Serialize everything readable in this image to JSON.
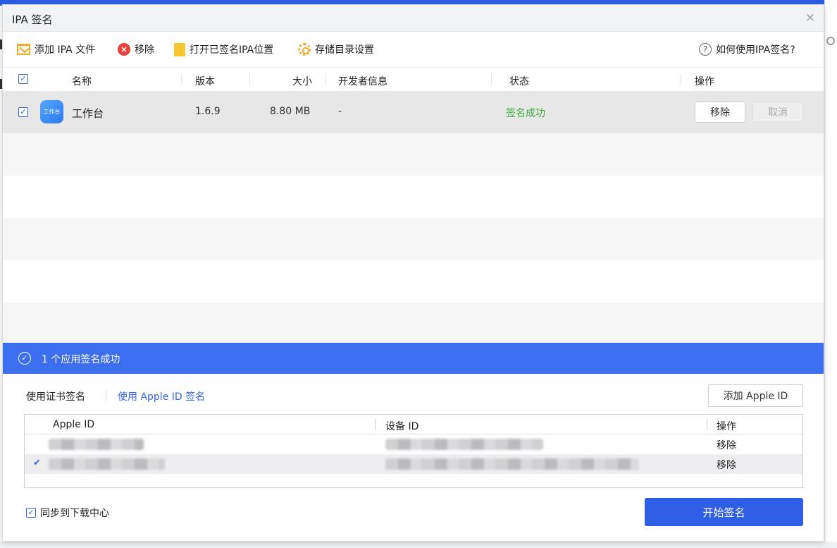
{
  "dialog": {
    "title": "IPA 签名",
    "close": "×"
  },
  "toolbar": {
    "add_ipa": "添加 IPA 文件",
    "remove": "移除",
    "open_signed": "打开已签名IPA位置",
    "storage_settings": "存储目录设置",
    "help": "如何使用IPA签名?",
    "help_glyph": "?"
  },
  "table": {
    "columns": [
      "名称",
      "版本",
      "大小",
      "开发者信息",
      "状态",
      "操作"
    ],
    "rows": [
      {
        "checked": true,
        "icon_text": "工作台",
        "name": "工作台",
        "version": "1.6.9",
        "size": "8.80 MB",
        "developer": "-",
        "status": "签名成功",
        "remove_btn": "移除",
        "cancel_btn": "取消"
      }
    ]
  },
  "banner": {
    "text": "1 个应用签名成功",
    "glyph": "✓"
  },
  "sign_tabs": {
    "cert": "使用证书签名",
    "apple_id": "使用 Apple ID 签名"
  },
  "add_apple_id": "添加 Apple ID",
  "apple_id_table": {
    "col_apple_id": "Apple ID",
    "col_device_id": "设备 ID",
    "col_action": "操作",
    "rows": [
      {
        "selected": false,
        "action": "移除"
      },
      {
        "selected": true,
        "action": "移除"
      }
    ]
  },
  "sync_download_center": "同步到下载中心",
  "start_sign": "开始签名",
  "colors": {
    "accent": "#3b6ff0",
    "primary_button": "#2f5ee6",
    "success": "#3fae3f"
  },
  "icons": [
    "folder-add-icon",
    "remove-icon",
    "folder-open-icon",
    "gear-icon",
    "help-icon",
    "check-circle-icon",
    "checkmark-icon"
  ]
}
